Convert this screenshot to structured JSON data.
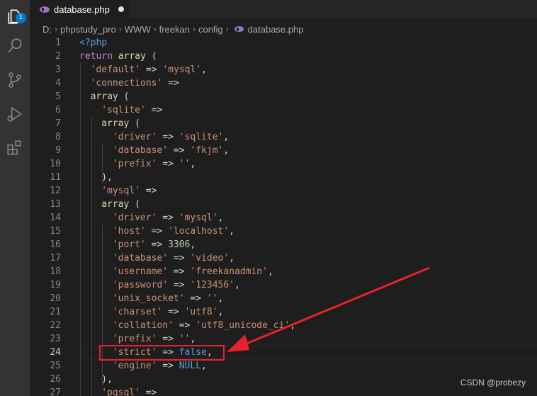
{
  "activity_bar": {
    "items": [
      "explorer-icon",
      "search-icon",
      "source-control-icon",
      "run-debug-icon",
      "extensions-icon"
    ],
    "explorer_badge": "1"
  },
  "tab": {
    "label": "database.php",
    "icon": "php-elephant-icon"
  },
  "breadcrumb": [
    "D:",
    "phpstudy_pro",
    "WWW",
    "freekan",
    "config",
    "database.php"
  ],
  "editor": {
    "current_line": 24,
    "lines": [
      {
        "n": 1,
        "indent": 0,
        "tokens": [
          [
            "tag",
            "<?php"
          ]
        ]
      },
      {
        "n": 2,
        "indent": 0,
        "tokens": [
          [
            "kw",
            "return"
          ],
          [
            "op",
            " "
          ],
          [
            "fn",
            "array"
          ],
          [
            "op",
            " ("
          ]
        ]
      },
      {
        "n": 3,
        "indent": 2,
        "tokens": [
          [
            "str",
            "'default'"
          ],
          [
            "op",
            " => "
          ],
          [
            "str",
            "'mysql'"
          ],
          [
            "op",
            ","
          ]
        ]
      },
      {
        "n": 4,
        "indent": 2,
        "tokens": [
          [
            "str",
            "'connections'"
          ],
          [
            "op",
            " =>"
          ]
        ]
      },
      {
        "n": 5,
        "indent": 2,
        "tokens": [
          [
            "fn",
            "array"
          ],
          [
            "op",
            " ("
          ]
        ]
      },
      {
        "n": 6,
        "indent": 4,
        "tokens": [
          [
            "str",
            "'sqlite'"
          ],
          [
            "op",
            " =>"
          ]
        ]
      },
      {
        "n": 7,
        "indent": 4,
        "tokens": [
          [
            "fn",
            "array"
          ],
          [
            "op",
            " ("
          ]
        ]
      },
      {
        "n": 8,
        "indent": 6,
        "tokens": [
          [
            "str",
            "'driver'"
          ],
          [
            "op",
            " => "
          ],
          [
            "str",
            "'sqlite'"
          ],
          [
            "op",
            ","
          ]
        ]
      },
      {
        "n": 9,
        "indent": 6,
        "tokens": [
          [
            "str",
            "'database'"
          ],
          [
            "op",
            " => "
          ],
          [
            "str",
            "'fkjm'"
          ],
          [
            "op",
            ","
          ]
        ]
      },
      {
        "n": 10,
        "indent": 6,
        "tokens": [
          [
            "str",
            "'prefix'"
          ],
          [
            "op",
            " => "
          ],
          [
            "str",
            "''"
          ],
          [
            "op",
            ","
          ]
        ]
      },
      {
        "n": 11,
        "indent": 4,
        "tokens": [
          [
            "op",
            "),"
          ]
        ]
      },
      {
        "n": 12,
        "indent": 4,
        "tokens": [
          [
            "str",
            "'mysql'"
          ],
          [
            "op",
            " =>"
          ]
        ]
      },
      {
        "n": 13,
        "indent": 4,
        "tokens": [
          [
            "fn",
            "array"
          ],
          [
            "op",
            " ("
          ]
        ]
      },
      {
        "n": 14,
        "indent": 6,
        "tokens": [
          [
            "str",
            "'driver'"
          ],
          [
            "op",
            " => "
          ],
          [
            "str",
            "'mysql'"
          ],
          [
            "op",
            ","
          ]
        ]
      },
      {
        "n": 15,
        "indent": 6,
        "tokens": [
          [
            "str",
            "'host'"
          ],
          [
            "op",
            " => "
          ],
          [
            "str",
            "'localhost'"
          ],
          [
            "op",
            ","
          ]
        ]
      },
      {
        "n": 16,
        "indent": 6,
        "tokens": [
          [
            "str",
            "'port'"
          ],
          [
            "op",
            " => "
          ],
          [
            "num",
            "3306"
          ],
          [
            "op",
            ","
          ]
        ]
      },
      {
        "n": 17,
        "indent": 6,
        "tokens": [
          [
            "str",
            "'database'"
          ],
          [
            "op",
            " => "
          ],
          [
            "str",
            "'video'"
          ],
          [
            "op",
            ","
          ]
        ]
      },
      {
        "n": 18,
        "indent": 6,
        "tokens": [
          [
            "str",
            "'username'"
          ],
          [
            "op",
            " => "
          ],
          [
            "str",
            "'freekanadmin'"
          ],
          [
            "op",
            ","
          ]
        ]
      },
      {
        "n": 19,
        "indent": 6,
        "tokens": [
          [
            "str",
            "'password'"
          ],
          [
            "op",
            " => "
          ],
          [
            "str",
            "'123456'"
          ],
          [
            "op",
            ","
          ]
        ]
      },
      {
        "n": 20,
        "indent": 6,
        "tokens": [
          [
            "str",
            "'unix_socket'"
          ],
          [
            "op",
            " => "
          ],
          [
            "str",
            "''"
          ],
          [
            "op",
            ","
          ]
        ]
      },
      {
        "n": 21,
        "indent": 6,
        "tokens": [
          [
            "str",
            "'charset'"
          ],
          [
            "op",
            " => "
          ],
          [
            "str",
            "'utf8'"
          ],
          [
            "op",
            ","
          ]
        ]
      },
      {
        "n": 22,
        "indent": 6,
        "tokens": [
          [
            "str",
            "'collation'"
          ],
          [
            "op",
            " => "
          ],
          [
            "str",
            "'utf8_unicode_ci'"
          ],
          [
            "op",
            ","
          ]
        ]
      },
      {
        "n": 23,
        "indent": 6,
        "tokens": [
          [
            "str",
            "'prefix'"
          ],
          [
            "op",
            " => "
          ],
          [
            "str",
            "''"
          ],
          [
            "op",
            ","
          ]
        ]
      },
      {
        "n": 24,
        "indent": 6,
        "tokens": [
          [
            "str",
            "'strict'"
          ],
          [
            "op",
            " => "
          ],
          [
            "const",
            "false"
          ],
          [
            "op",
            ","
          ]
        ]
      },
      {
        "n": 25,
        "indent": 6,
        "tokens": [
          [
            "str",
            "'engine'"
          ],
          [
            "op",
            " => "
          ],
          [
            "const",
            "NULL"
          ],
          [
            "op",
            ","
          ]
        ]
      },
      {
        "n": 26,
        "indent": 4,
        "tokens": [
          [
            "op",
            "),"
          ]
        ]
      },
      {
        "n": 27,
        "indent": 4,
        "tokens": [
          [
            "str",
            "'pgsql'"
          ],
          [
            "op",
            " =>"
          ]
        ]
      }
    ]
  },
  "annotation": {
    "color": "#e8222a",
    "highlighted_line": 24
  },
  "watermark": "CSDN @probezy"
}
